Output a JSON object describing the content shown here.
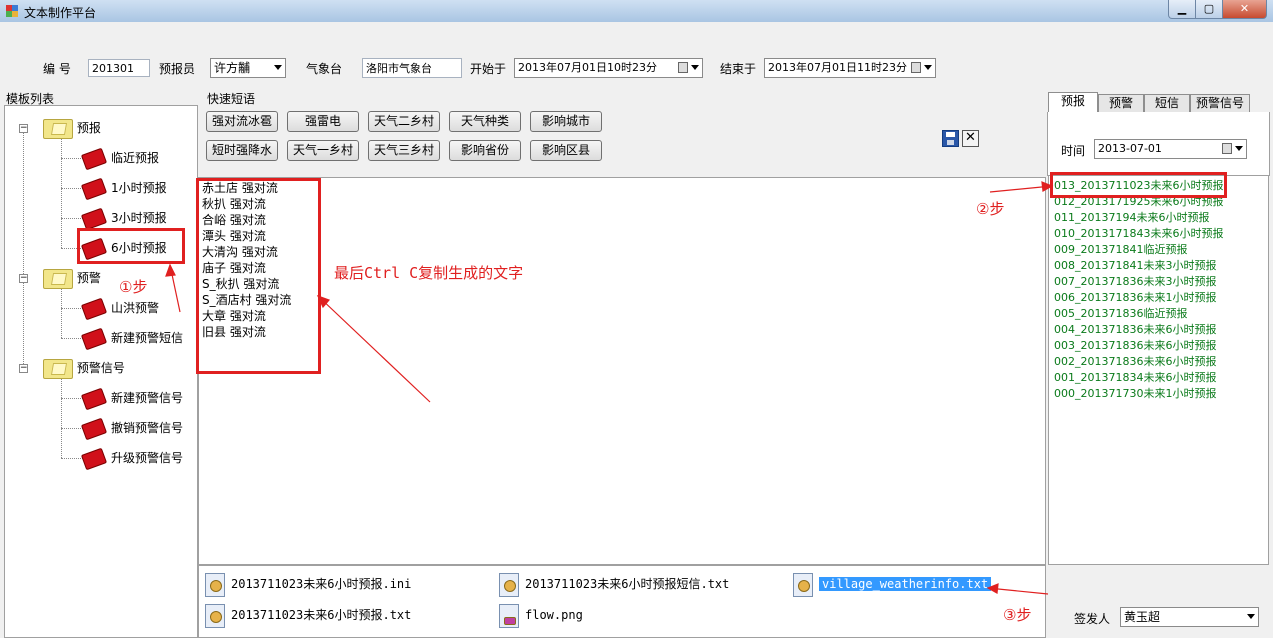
{
  "window": {
    "title": "文本制作平台"
  },
  "form": {
    "number_label": "编 号",
    "number_value": "201301",
    "forecaster_label": "预报员",
    "forecaster_value": "许方黼",
    "station_label": "气象台",
    "station_value": "洛阳市气象台",
    "start_label": "开始于",
    "start_value": "2013年07月01日10时23分",
    "end_label": "结束于",
    "end_value": "2013年07月01日11时23分"
  },
  "tree": {
    "title": "模板列表",
    "groups": [
      {
        "label": "预报",
        "items": [
          "临近预报",
          "1小时预报",
          "3小时预报",
          "6小时预报"
        ]
      },
      {
        "label": "预警",
        "items": [
          "山洪预警",
          "新建预警短信"
        ]
      },
      {
        "label": "预警信号",
        "items": [
          "新建预警信号",
          "撤销预警信号",
          "升级预警信号"
        ]
      }
    ]
  },
  "quick": {
    "title": "快速短语",
    "row1": [
      "强对流冰雹",
      "强雷电",
      "天气二乡村",
      "天气种类",
      "影响城市"
    ],
    "row2": [
      "短时强降水",
      "天气一乡村",
      "天气三乡村",
      "影响省份",
      "影响区县"
    ]
  },
  "editor": {
    "lines": [
      "赤土店 强对流",
      "秋扒 强对流",
      "合峪 强对流",
      "潭头 强对流",
      "大清沟 强对流",
      "庙子 强对流",
      "S_秋扒 强对流",
      "S_酒店村 强对流",
      "大章 强对流",
      "旧县 强对流"
    ]
  },
  "files": {
    "items": [
      "2013711023未来6小时预报.ini",
      "2013711023未来6小时预报短信.txt",
      "village_weatherinfo.txt",
      "2013711023未来6小时预报.txt",
      "flow.png"
    ]
  },
  "right": {
    "tabs": [
      "预报",
      "预警",
      "短信",
      "预警信号"
    ],
    "time_label": "时间",
    "time_value": "2013-07-01",
    "list": [
      "013_2013711023未来6小时预报",
      "012_2013171925未来6小时预报",
      "011_2013719​4未来6小时预报",
      "010_2013171843未来6小时预报",
      "009_201371841临近预报",
      "008_201371841未来3小时预报",
      "007_201371836未来3小时预报",
      "006_201371836未来1小时预报",
      "005_201371836临近预报",
      "004_201371836未来6小时预报",
      "003_201371836未来6小时预报",
      "002_201371836未来6小时预报",
      "001_201371834未来6小时预报",
      "000_201371730未来1小时预报"
    ],
    "signer_label": "签发人",
    "signer_value": "黄玉超"
  },
  "annotations": {
    "step1": "①步",
    "step2": "②步",
    "step3": "③步",
    "note": "最后Ctrl C复制生成的文字"
  },
  "colors": {
    "annotation": "#e02020",
    "list_text": "#0a7a1a",
    "selection": "#3399ff"
  }
}
